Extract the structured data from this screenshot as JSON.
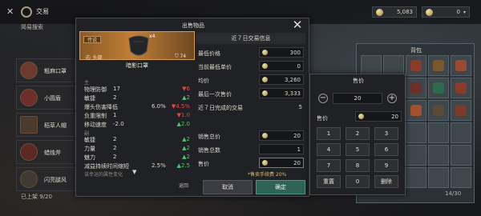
{
  "app": {
    "title": "交易"
  },
  "currency": {
    "coins": "5,083",
    "tokens": "0"
  },
  "market": {
    "search_title": "简易搜索",
    "items": [
      {
        "name": "粗麻口罩"
      },
      {
        "name": "小圆盾"
      },
      {
        "name": "稻草人帽"
      },
      {
        "name": "蜡烛斧"
      },
      {
        "name": "闪亮腿风"
      }
    ],
    "listed_count": "已上架  9/20"
  },
  "bag": {
    "title": "背包",
    "count": "14/30"
  },
  "dialog": {
    "title": "出售物品",
    "item": {
      "rarity": "传说",
      "slot": "头部",
      "quantity": "4",
      "durability": "74",
      "name": "暗影口罩"
    },
    "sections": {
      "main": "主",
      "sub": "副"
    },
    "main_stats": [
      {
        "label": "物理防御",
        "value": "17",
        "delta": "6",
        "dir": "down"
      },
      {
        "label": "敏捷",
        "value": "2",
        "delta": "2",
        "dir": "up"
      },
      {
        "label": "爆头伤害降低",
        "value": "6.0%",
        "delta": "4.5%",
        "dir": "down"
      },
      {
        "label": "负重限制",
        "value": "1",
        "delta": "1.0",
        "dir": "down"
      },
      {
        "label": "移动速度",
        "value": "-2.0",
        "delta": "2.0",
        "dir": "up"
      }
    ],
    "sub_stats": [
      {
        "label": "敏捷",
        "value": "2",
        "delta": "2",
        "dir": "up"
      },
      {
        "label": "力量",
        "value": "2",
        "delta": "2",
        "dir": "up"
      },
      {
        "label": "魅力",
        "value": "2",
        "delta": "2",
        "dir": "up"
      },
      {
        "label": "减益持续时间缩短",
        "value": "2.5%",
        "delta": "2.5",
        "dir": "up"
      }
    ],
    "more_stats": "该幸运的属性变化",
    "expand_label": "返回",
    "history": {
      "title": "近７日交易信息",
      "rows": [
        {
          "label": "最低价格",
          "value": "300"
        },
        {
          "label": "当前最低单价",
          "value": "0"
        },
        {
          "label": "均价",
          "value": "3,260"
        },
        {
          "label": "最后一次售价",
          "value": "3,333"
        },
        {
          "label": "近７日完成的交易",
          "value": "5"
        }
      ]
    },
    "sale": {
      "total_label": "销售总价",
      "total": "20",
      "count_label": "销售总数",
      "count": "1",
      "price_label": "售价",
      "price": "20"
    },
    "fee_note": "*售卖手续费 20%",
    "cancel_label": "取消",
    "confirm_label": "确定"
  },
  "price_panel": {
    "title": "售价",
    "quantity": "20",
    "unit_label": "售价",
    "unit_price": "20",
    "keys": [
      "1",
      "2",
      "3",
      "4",
      "5",
      "6",
      "7",
      "8",
      "9",
      "重置",
      "0",
      "删除"
    ]
  },
  "colors": {
    "accent": "#2f6355",
    "legendary": "#c27e35",
    "up": "#49c46a",
    "down": "#e24646",
    "fee": "#ddb865"
  }
}
